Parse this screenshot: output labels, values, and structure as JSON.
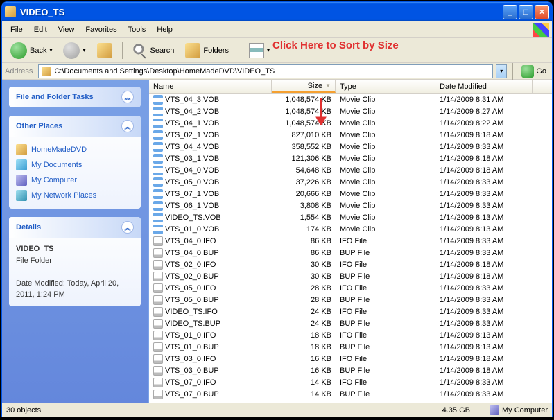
{
  "window": {
    "title": "VIDEO_TS"
  },
  "menu": {
    "file": "File",
    "edit": "Edit",
    "view": "View",
    "favorites": "Favorites",
    "tools": "Tools",
    "help": "Help"
  },
  "toolbar": {
    "back": "Back",
    "search": "Search",
    "folders": "Folders"
  },
  "annotation": {
    "text": "Click Here to Sort by Size"
  },
  "address": {
    "label": "Address",
    "path": "C:\\Documents and Settings\\Desktop\\HomeMadeDVD\\VIDEO_TS",
    "go": "Go"
  },
  "sidebar": {
    "tasks": {
      "title": "File and Folder Tasks"
    },
    "places": {
      "title": "Other Places",
      "items": [
        {
          "label": "HomeMadeDVD",
          "icon": "pi-folder"
        },
        {
          "label": "My Documents",
          "icon": "pi-docs"
        },
        {
          "label": "My Computer",
          "icon": "pi-computer"
        },
        {
          "label": "My Network Places",
          "icon": "pi-network"
        }
      ]
    },
    "details": {
      "title": "Details",
      "name": "VIDEO_TS",
      "type": "File Folder",
      "modified": "Date Modified: Today, April 20, 2011, 1:24 PM"
    }
  },
  "columns": {
    "name": "Name",
    "size": "Size",
    "type": "Type",
    "date": "Date Modified"
  },
  "files": [
    {
      "name": "VTS_04_3.VOB",
      "size": "1,048,574 KB",
      "type": "Movie Clip",
      "date": "1/14/2009 8:31 AM",
      "icon": "ico-movie"
    },
    {
      "name": "VTS_04_2.VOB",
      "size": "1,048,574 KB",
      "type": "Movie Clip",
      "date": "1/14/2009 8:27 AM",
      "icon": "ico-movie"
    },
    {
      "name": "VTS_04_1.VOB",
      "size": "1,048,574 KB",
      "type": "Movie Clip",
      "date": "1/14/2009 8:22 AM",
      "icon": "ico-movie"
    },
    {
      "name": "VTS_02_1.VOB",
      "size": "827,010 KB",
      "type": "Movie Clip",
      "date": "1/14/2009 8:18 AM",
      "icon": "ico-movie"
    },
    {
      "name": "VTS_04_4.VOB",
      "size": "358,552 KB",
      "type": "Movie Clip",
      "date": "1/14/2009 8:33 AM",
      "icon": "ico-movie"
    },
    {
      "name": "VTS_03_1.VOB",
      "size": "121,306 KB",
      "type": "Movie Clip",
      "date": "1/14/2009 8:18 AM",
      "icon": "ico-movie"
    },
    {
      "name": "VTS_04_0.VOB",
      "size": "54,648 KB",
      "type": "Movie Clip",
      "date": "1/14/2009 8:18 AM",
      "icon": "ico-movie"
    },
    {
      "name": "VTS_05_0.VOB",
      "size": "37,226 KB",
      "type": "Movie Clip",
      "date": "1/14/2009 8:33 AM",
      "icon": "ico-movie"
    },
    {
      "name": "VTS_07_1.VOB",
      "size": "20,666 KB",
      "type": "Movie Clip",
      "date": "1/14/2009 8:33 AM",
      "icon": "ico-movie"
    },
    {
      "name": "VTS_06_1.VOB",
      "size": "3,808 KB",
      "type": "Movie Clip",
      "date": "1/14/2009 8:33 AM",
      "icon": "ico-movie"
    },
    {
      "name": "VIDEO_TS.VOB",
      "size": "1,554 KB",
      "type": "Movie Clip",
      "date": "1/14/2009 8:13 AM",
      "icon": "ico-movie"
    },
    {
      "name": "VTS_01_0.VOB",
      "size": "174 KB",
      "type": "Movie Clip",
      "date": "1/14/2009 8:13 AM",
      "icon": "ico-movie"
    },
    {
      "name": "VTS_04_0.IFO",
      "size": "86 KB",
      "type": "IFO File",
      "date": "1/14/2009 8:33 AM",
      "icon": "ico-ifo"
    },
    {
      "name": "VTS_04_0.BUP",
      "size": "86 KB",
      "type": "BUP File",
      "date": "1/14/2009 8:33 AM",
      "icon": "ico-bup"
    },
    {
      "name": "VTS_02_0.IFO",
      "size": "30 KB",
      "type": "IFO File",
      "date": "1/14/2009 8:18 AM",
      "icon": "ico-ifo"
    },
    {
      "name": "VTS_02_0.BUP",
      "size": "30 KB",
      "type": "BUP File",
      "date": "1/14/2009 8:18 AM",
      "icon": "ico-bup"
    },
    {
      "name": "VTS_05_0.IFO",
      "size": "28 KB",
      "type": "IFO File",
      "date": "1/14/2009 8:33 AM",
      "icon": "ico-ifo"
    },
    {
      "name": "VTS_05_0.BUP",
      "size": "28 KB",
      "type": "BUP File",
      "date": "1/14/2009 8:33 AM",
      "icon": "ico-bup"
    },
    {
      "name": "VIDEO_TS.IFO",
      "size": "24 KB",
      "type": "IFO File",
      "date": "1/14/2009 8:33 AM",
      "icon": "ico-ifo"
    },
    {
      "name": "VIDEO_TS.BUP",
      "size": "24 KB",
      "type": "BUP File",
      "date": "1/14/2009 8:33 AM",
      "icon": "ico-bup"
    },
    {
      "name": "VTS_01_0.IFO",
      "size": "18 KB",
      "type": "IFO File",
      "date": "1/14/2009 8:13 AM",
      "icon": "ico-ifo"
    },
    {
      "name": "VTS_01_0.BUP",
      "size": "18 KB",
      "type": "BUP File",
      "date": "1/14/2009 8:13 AM",
      "icon": "ico-bup"
    },
    {
      "name": "VTS_03_0.IFO",
      "size": "16 KB",
      "type": "IFO File",
      "date": "1/14/2009 8:18 AM",
      "icon": "ico-ifo"
    },
    {
      "name": "VTS_03_0.BUP",
      "size": "16 KB",
      "type": "BUP File",
      "date": "1/14/2009 8:18 AM",
      "icon": "ico-bup"
    },
    {
      "name": "VTS_07_0.IFO",
      "size": "14 KB",
      "type": "IFO File",
      "date": "1/14/2009 8:33 AM",
      "icon": "ico-ifo"
    },
    {
      "name": "VTS_07_0.BUP",
      "size": "14 KB",
      "type": "BUP File",
      "date": "1/14/2009 8:33 AM",
      "icon": "ico-bup"
    }
  ],
  "statusbar": {
    "objects": "30 objects",
    "disk": "4.35 GB",
    "location": "My Computer"
  }
}
